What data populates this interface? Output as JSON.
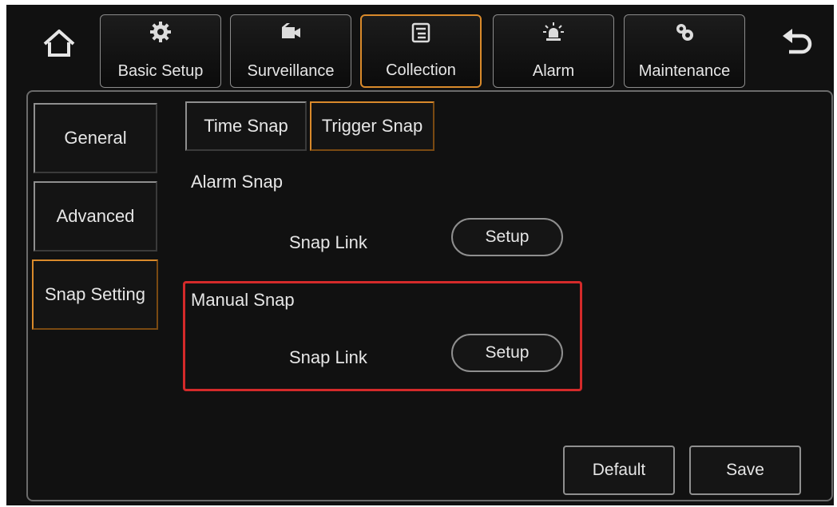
{
  "nav": {
    "home_icon": "home-icon",
    "back_icon": "back-arrow-icon",
    "tabs": [
      {
        "label": "Basic Setup",
        "icon": "gear-icon",
        "active": false
      },
      {
        "label": "Surveillance",
        "icon": "camera-icon",
        "active": false
      },
      {
        "label": "Collection",
        "icon": "document-icon",
        "active": true
      },
      {
        "label": "Alarm",
        "icon": "alarm-light-icon",
        "active": false
      },
      {
        "label": "Maintenance",
        "icon": "gears-icon",
        "active": false
      }
    ]
  },
  "sidebar": {
    "items": [
      {
        "label": "General",
        "active": false
      },
      {
        "label": "Advanced",
        "active": false
      },
      {
        "label": "Snap Setting",
        "active": true
      }
    ]
  },
  "subtabs": [
    {
      "label": "Time Snap",
      "active": false
    },
    {
      "label": "Trigger Snap",
      "active": true
    }
  ],
  "sections": {
    "alarm": {
      "title": "Alarm Snap",
      "row_label": "Snap Link",
      "button": "Setup"
    },
    "manual": {
      "title": "Manual Snap",
      "row_label": "Snap Link",
      "button": "Setup"
    }
  },
  "footer": {
    "default_label": "Default",
    "save_label": "Save"
  },
  "colors": {
    "accent": "#d98a2b",
    "highlight": "#d42a2a",
    "background": "#111111"
  }
}
